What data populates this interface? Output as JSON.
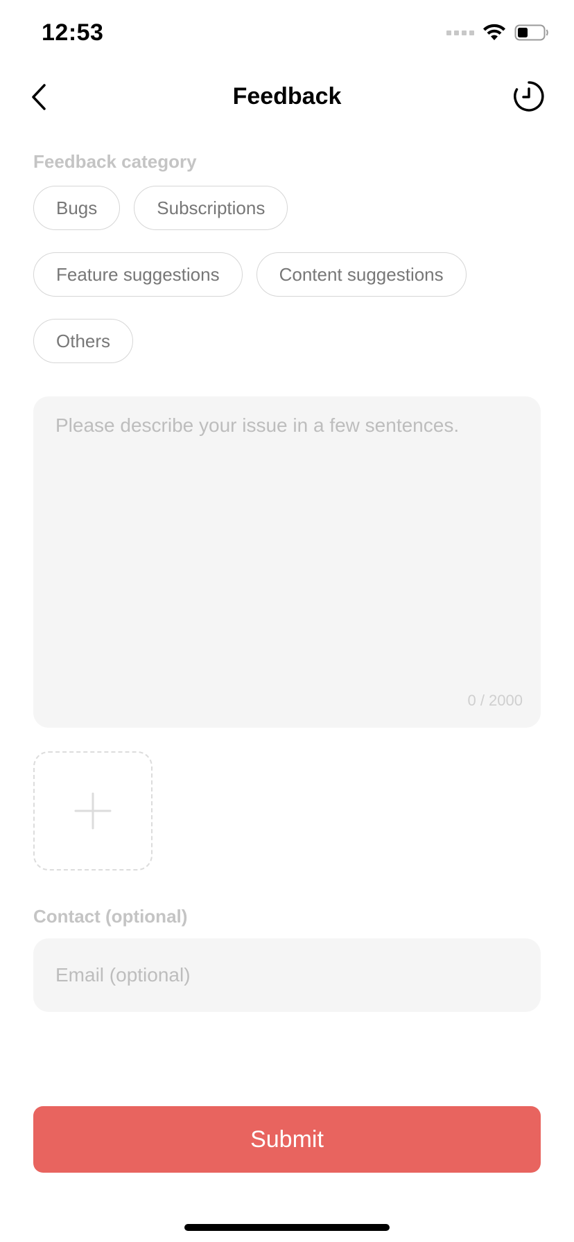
{
  "status_bar": {
    "time": "12:53"
  },
  "nav": {
    "title": "Feedback"
  },
  "category": {
    "label": "Feedback category",
    "rows": [
      [
        "Bugs",
        "Subscriptions"
      ],
      [
        "Feature suggestions",
        "Content suggestions"
      ],
      [
        "Others"
      ]
    ]
  },
  "description": {
    "value": "",
    "placeholder": "Please describe your issue in a few sentences.",
    "counter": "0 / 2000"
  },
  "contact": {
    "label": "Contact (optional)",
    "email_value": "",
    "email_placeholder": "Email (optional)"
  },
  "submit": {
    "label": "Submit"
  },
  "colors": {
    "accent": "#E8645F",
    "chip_border": "#D6D6D6",
    "field_bg": "#F5F5F5",
    "label_gray": "#C4C4C4"
  },
  "icons": {
    "back": "chevron-left-icon",
    "history": "history-clock-icon",
    "add_image": "plus-icon",
    "wifi": "wifi-icon",
    "battery": "battery-icon"
  }
}
